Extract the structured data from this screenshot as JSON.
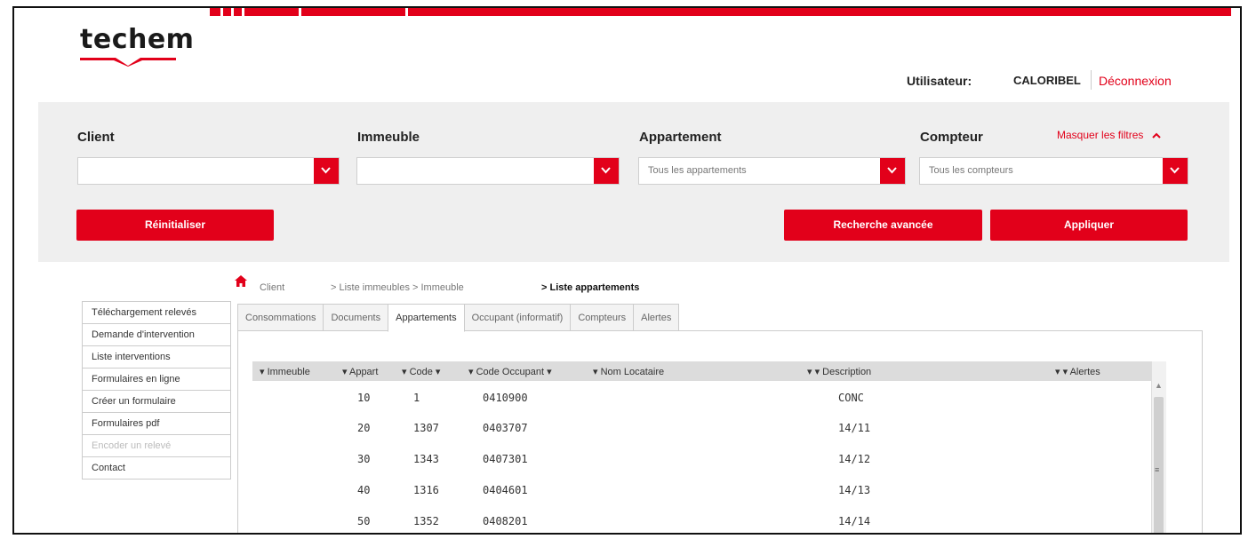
{
  "header": {
    "logo_text": "techem",
    "user_label": "Utilisateur:",
    "user_name": "CALORIBEL",
    "logout_label": "Déconnexion"
  },
  "filters": {
    "client_label": "Client",
    "immeuble_label": "Immeuble",
    "appartement_label": "Appartement",
    "compteur_label": "Compteur",
    "hide_filters_label": "Masquer les filtres",
    "client_value": "",
    "immeuble_value": "",
    "appartement_value": "Tous les appartements",
    "compteur_value": "Tous les compteurs",
    "reset_label": "Réinitialiser",
    "advanced_search_label": "Recherche avancée",
    "apply_label": "Appliquer"
  },
  "breadcrumb": {
    "client": "Client",
    "immeubles": "> Liste immeubles > Immeuble",
    "current": "> Liste appartements"
  },
  "side_menu": {
    "items": [
      {
        "label": "Téléchargement relevés",
        "enabled": true
      },
      {
        "label": "Demande d'intervention",
        "enabled": true
      },
      {
        "label": "Liste interventions",
        "enabled": true
      },
      {
        "label": "Formulaires en ligne",
        "enabled": true
      },
      {
        "label": "Créer un formulaire",
        "enabled": true
      },
      {
        "label": "Formulaires pdf",
        "enabled": true
      },
      {
        "label": "Encoder un relevé",
        "enabled": false
      },
      {
        "label": "Contact",
        "enabled": true
      }
    ]
  },
  "tabs": {
    "items": [
      {
        "label": "Consommations"
      },
      {
        "label": "Documents"
      },
      {
        "label": "Appartements"
      },
      {
        "label": "Occupant (informatif)"
      },
      {
        "label": "Compteurs"
      },
      {
        "label": "Alertes"
      }
    ],
    "active": "Appartements"
  },
  "grid": {
    "columns": [
      "Immeuble",
      "Appart",
      "Code",
      "Code Occupant",
      "Nom Locataire",
      "Description",
      "Alertes"
    ],
    "rows": [
      {
        "appart": "10",
        "code": "1",
        "occupant": "0410900",
        "locataire": "",
        "description": "CONC"
      },
      {
        "appart": "20",
        "code": "1307",
        "occupant": "0403707",
        "locataire": "",
        "description": "14/11"
      },
      {
        "appart": "30",
        "code": "1343",
        "occupant": "0407301",
        "locataire": "",
        "description": "14/12"
      },
      {
        "appart": "40",
        "code": "1316",
        "occupant": "0404601",
        "locataire": "",
        "description": "14/13"
      },
      {
        "appart": "50",
        "code": "1352",
        "occupant": "0408201",
        "locataire": "",
        "description": "14/14"
      }
    ]
  },
  "colors": {
    "accent": "#e2001a",
    "panel": "#efefef"
  }
}
